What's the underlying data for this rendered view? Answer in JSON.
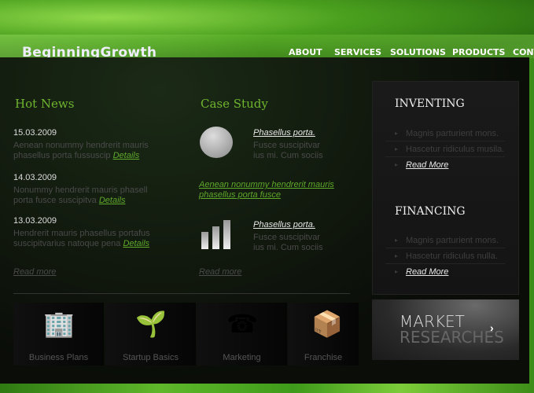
{
  "header": {
    "logo": "BeginningGrowth",
    "nav": [
      "ABOUT",
      "SERVICES",
      "SOLUTIONS",
      "PRODUCTS",
      "CONTACTS"
    ]
  },
  "hot_news": {
    "title": "Hot News",
    "items": [
      {
        "date": "15.03.2009",
        "line1": "Aenean nonummy hendrerit mauris",
        "line2": "phasellus porta fussuscip",
        "link": "Details"
      },
      {
        "date": "14.03.2009",
        "line1": "Nonummy hendrerit mauris phasell",
        "line2": "porta fusce suscipitva",
        "link": "Details"
      },
      {
        "date": "13.03.2009",
        "line1": "Hendrerit mauris phasellus portafus",
        "line2": "suscipitvarius natoque pena",
        "link": "Details"
      }
    ],
    "read_more": "Read more"
  },
  "case_study": {
    "title": "Case Study",
    "items": [
      {
        "icon": "speech-bubble-icon",
        "title": "Phasellus porta.",
        "line1": "Fusce suscipitvar",
        "line2": "ius mi. Cum sociis"
      },
      {
        "icon": "bar-chart-icon",
        "title": "Phasellus porta.",
        "line1": "Fusce suscipitvar",
        "line2": "ius mi. Cum sociis"
      }
    ],
    "link1": "Aenean nonummy hendrerit mauris",
    "link2": "phasellus porta fusce",
    "read_more": "Read more"
  },
  "sidebar": {
    "sections": [
      {
        "title": "INVENTING",
        "items": [
          "Magnis parturient mons.",
          "Hascetur ridiculus musila."
        ],
        "read_more": "Read More"
      },
      {
        "title": "FINANCING",
        "items": [
          "Magnis parturient mons.",
          "Hascetur ridiculus nulla."
        ],
        "read_more": "Read More"
      }
    ],
    "banner": {
      "line1": "MARKET",
      "line2": "RESEARCHES"
    }
  },
  "tiles": [
    {
      "label": "Business Plans",
      "icon": "skyscraper-icon"
    },
    {
      "label": "Startup Basics",
      "icon": "sprout-icon"
    },
    {
      "label": "Marketing",
      "icon": "telephone-icon"
    },
    {
      "label": "Franchise",
      "icon": "crate-icon"
    }
  ]
}
